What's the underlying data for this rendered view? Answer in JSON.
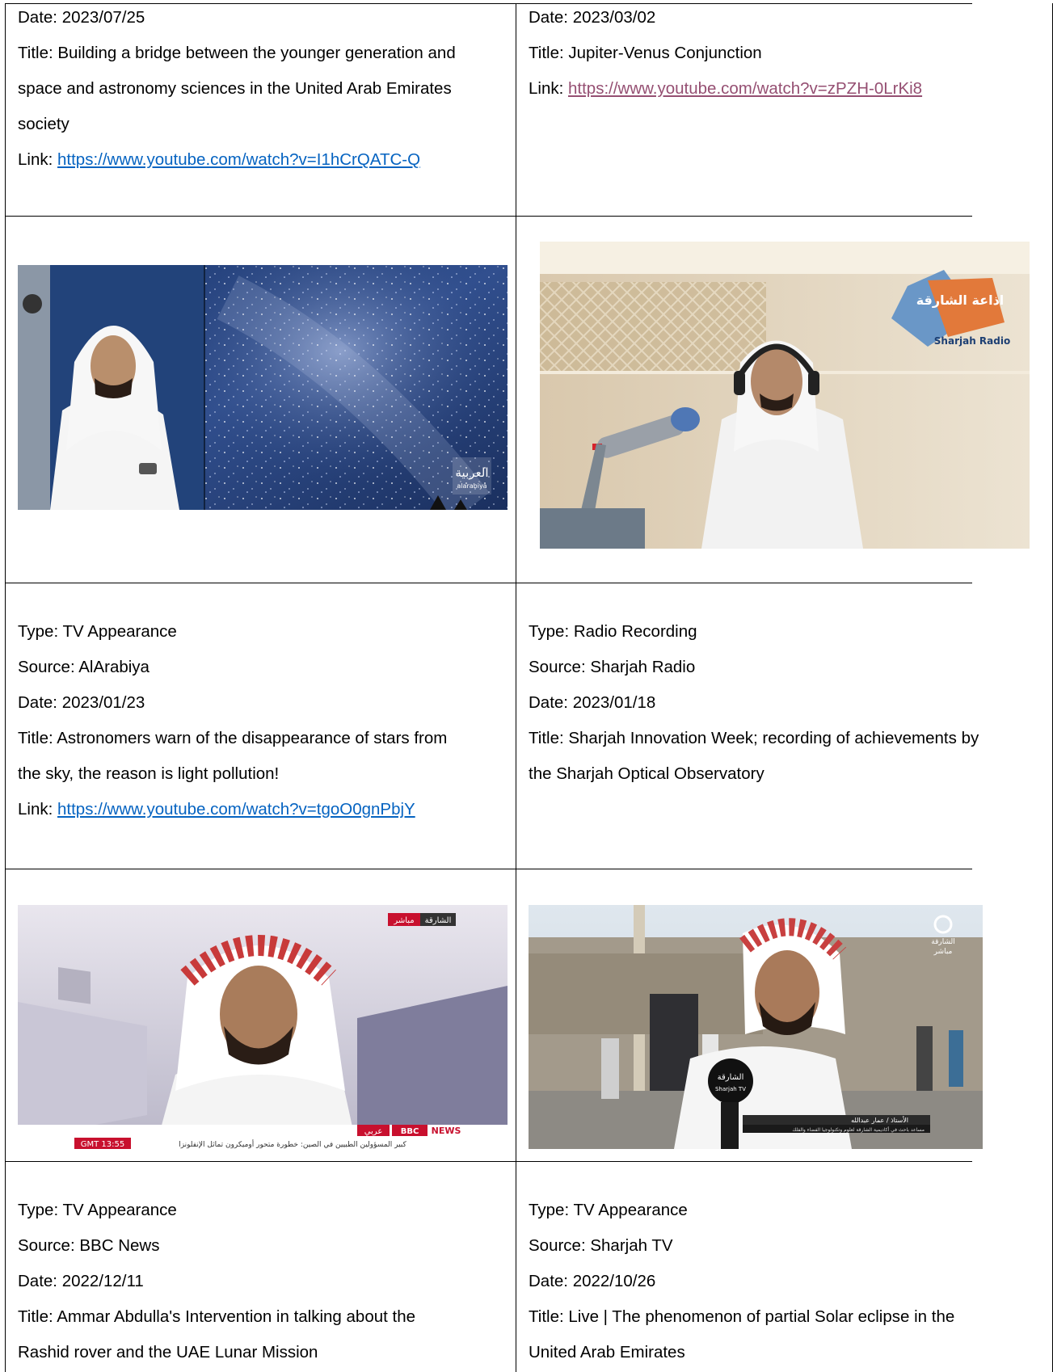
{
  "cells": {
    "r1_left": {
      "date": "Date: 2023/07/25",
      "title_line1": "Title: Building a bridge between the younger generation and",
      "title_line2": "space and astronomy sciences in the United Arab Emirates",
      "title_line3": "society",
      "link_label": "Link: ",
      "link_url": "https://www.youtube.com/watch?v=I1hCrQATC-Q"
    },
    "r1_right": {
      "date": "Date: 2023/03/02",
      "title": "Title: Jupiter-Venus Conjunction",
      "link_label": "Link: ",
      "link_url": "https://www.youtube.com/watch?v=zPZH-0LrKi8"
    },
    "r3_left": {
      "type": "Type: TV Appearance",
      "source": "Source: AlArabiya",
      "date": "Date: 2023/01/23",
      "title_line1": "Title: Astronomers warn of the disappearance of stars from",
      "title_line2": "the sky, the reason is light pollution!",
      "link_label": "Link: ",
      "link_url": "https://www.youtube.com/watch?v=tgoO0gnPbjY"
    },
    "r3_right": {
      "type": "Type: Radio Recording",
      "source": "Source: Sharjah Radio",
      "date": "Date: 2023/01/18",
      "title_line1": "Title: Sharjah Innovation Week; recording of achievements by",
      "title_line2": "the Sharjah Optical Observatory"
    },
    "r5_left": {
      "type": "Type: TV Appearance",
      "source": "Source: BBC News",
      "date": "Date: 2022/12/11",
      "title_line1": "Title: Ammar Abdulla's Intervention in talking about the",
      "title_line2": "Rashid rover and the UAE Lunar Mission"
    },
    "r5_right": {
      "type": "Type: TV Appearance",
      "source": "Source: Sharjah TV",
      "date": "Date: 2022/10/26",
      "title_line1": "Title: Live | The phenomenon of partial Solar eclipse in the",
      "title_line2": "United Arab Emirates"
    }
  },
  "images": {
    "alarabiya": {
      "logo": "العربية",
      "logo_sub": "alarabiya"
    },
    "sharjah_radio": {
      "logo": "اذاعة الشارقة",
      "logo_en": "Sharjah Radio"
    },
    "bbc": {
      "live_tag": "مباشر",
      "live_place": "الشارقة",
      "time": "GMT 13:55",
      "bbc": "BBC",
      "news": "NEWS",
      "arabic": "عربي",
      "ticker": "كبير المسؤولين الطبيين في الصين: خطورة متحور أوميكرون تماثل الإنفلونزا"
    },
    "sharjah_tv": {
      "logo": "الشارقة",
      "logo_sub": "مباشر",
      "mic": "الشارقة",
      "mic_en": "Sharjah TV",
      "name": "الأستاذ / عمار عبدالله",
      "role": "مساعد باحث في أكاديمية الشارقة لعلوم وتكنولوجيا الفضاء والفلك"
    }
  },
  "colors": {
    "link": "#0563c1",
    "link_visited": "#954f72",
    "border": "#000000"
  }
}
